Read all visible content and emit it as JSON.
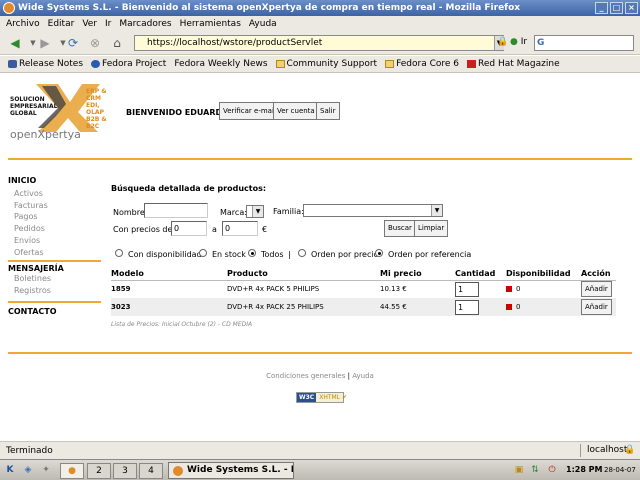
{
  "window": {
    "title": "Wide Systems S.L. - Bienvenido al sistema openXpertya de compra en tiempo real - Mozilla Firefox",
    "min": "_",
    "max": "□",
    "close": "×"
  },
  "menu": [
    "Archivo",
    "Editar",
    "Ver",
    "Ir",
    "Marcadores",
    "Herramientas",
    "Ayuda"
  ],
  "nav": {
    "url": "https://localhost/wstore/productServlet",
    "go": "Ir",
    "search_value": "G"
  },
  "bookmarks": [
    "Release Notes",
    "Fedora Project",
    "Fedora Weekly News",
    "Community Support",
    "Fedora Core 6",
    "Red Hat Magazine"
  ],
  "header": {
    "logo_line1": "SOLUCION",
    "logo_line2": "EMPRESARIAL",
    "logo_line3": "GLOBAL",
    "logo_tag1": "ERP & CRM",
    "logo_tag2": "EDI, OLAP",
    "logo_tag3": "B2B & B2C",
    "logo_brand": "openXpertya",
    "welcome": "BIENVENIDO EDUARDO",
    "btn_verify": "Verificar e-mail",
    "btn_account": "Ver cuenta",
    "btn_exit": "Salir"
  },
  "sidebar": {
    "inicio": "INICIO",
    "inicio_items": [
      "Activos",
      "Facturas",
      "Pagos",
      "Pedidos",
      "Envíos",
      "Ofertas"
    ],
    "mensajeria": "MENSAJERÍA",
    "mensajeria_items": [
      "Boletines",
      "Registros"
    ],
    "contacto": "CONTACTO"
  },
  "search": {
    "title": "Búsqueda detallada de productos:",
    "name_label": "Nombre:",
    "brand_label": "Marca:",
    "family_label": "Familia:",
    "price_label": "Con precios de:",
    "price_from": "0",
    "price_to_label": "a",
    "price_to": "0",
    "currency": "€",
    "btn_search": "Buscar",
    "btn_clear": "Limpiar",
    "opt_availability": "Con disponibilidad",
    "opt_stock": "En stock",
    "opt_all": "Todos",
    "sep": "|",
    "opt_order_price": "Orden por precio",
    "opt_order_ref": "Orden por referencia"
  },
  "table": {
    "headers": [
      "Modelo",
      "Producto",
      "Mi precio",
      "Cantidad",
      "Disponibilidad",
      "Acción"
    ],
    "rows": [
      {
        "model": "1859",
        "product": "DVD+R 4x PACK 5 PHILIPS",
        "price": "10.13 €",
        "qty": "1",
        "avail": "0",
        "action": "Añadir"
      },
      {
        "model": "3023",
        "product": "DVD+R 4x PACK 25 PHILIPS",
        "price": "44.55 €",
        "qty": "1",
        "avail": "0",
        "action": "Añadir"
      }
    ],
    "avail_color": "#cc0000"
  },
  "price_list_note": "Lista de Precios: Inicial Octubre (2) - CD MEDIA",
  "footer": {
    "conditions": "Condiciones generales",
    "sep": "|",
    "help": "Ayuda",
    "w3c": "W3C",
    "w3c_text": "XHTML"
  },
  "status": {
    "text": "Terminado",
    "host": "localhost"
  },
  "taskbar": {
    "ws2": "2",
    "ws3": "3",
    "ws4": "4",
    "task": "Wide Systems S.L. - Bien",
    "time": "1:28 PM",
    "date": "28-04-07"
  },
  "colors": {
    "accent": "#f0a830",
    "title_bar": "#3d63a6"
  }
}
